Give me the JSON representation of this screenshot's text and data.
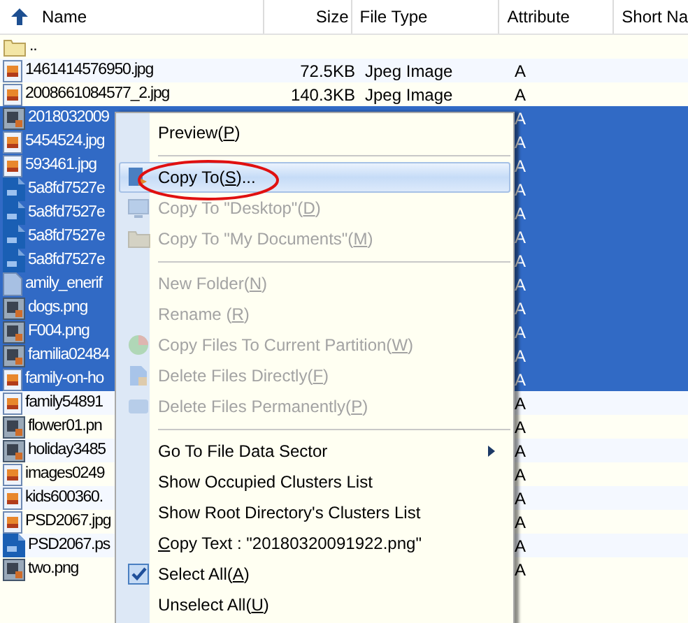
{
  "columns": [
    {
      "label": "Name"
    },
    {
      "label": "Size"
    },
    {
      "label": "File Type"
    },
    {
      "label": "Attribute"
    },
    {
      "label": "Short Na"
    }
  ],
  "rows": [
    {
      "kind": "folder",
      "name": "..",
      "selected": false
    },
    {
      "kind": "jpg",
      "name": "1461414576950.jpg",
      "size": "72.5KB",
      "type": "Jpeg Image",
      "attribute": "A",
      "selected": false
    },
    {
      "kind": "jpg",
      "name": "2008661084577_2.jpg",
      "size": "140.3KB",
      "type": "Jpeg Image",
      "attribute": "A",
      "selected": false
    },
    {
      "kind": "png",
      "name": "2018032009",
      "attribute": "A",
      "selected": true
    },
    {
      "kind": "jpg",
      "name": "5454524.jpg",
      "attribute": "A",
      "selected": true
    },
    {
      "kind": "jpg",
      "name": "593461.jpg",
      "attribute": "A",
      "selected": true
    },
    {
      "kind": "psd",
      "name": "5a8fd7527e",
      "attribute": "A",
      "selected": true
    },
    {
      "kind": "psd",
      "name": "5a8fd7527e",
      "attribute": "A",
      "selected": true
    },
    {
      "kind": "psd",
      "name": "5a8fd7527e",
      "attribute": "A",
      "selected": true
    },
    {
      "kind": "psd",
      "name": "5a8fd7527e",
      "attribute": "A",
      "selected": true
    },
    {
      "kind": "file",
      "name": "amily_enerif",
      "attribute": "A",
      "selected": true
    },
    {
      "kind": "png",
      "name": "dogs.png",
      "attribute": "A",
      "selected": true
    },
    {
      "kind": "png",
      "name": "F004.png",
      "attribute": "A",
      "selected": true
    },
    {
      "kind": "png",
      "name": "familia02484",
      "attribute": "A",
      "selected": true
    },
    {
      "kind": "jpg",
      "name": "family-on-ho",
      "attribute": "A",
      "selected": true
    },
    {
      "kind": "jpg",
      "name": "family54891",
      "attribute": "A",
      "selected": false
    },
    {
      "kind": "png",
      "name": "flower01.pn",
      "attribute": "A",
      "selected": false
    },
    {
      "kind": "png",
      "name": "holiday3485",
      "attribute": "A",
      "selected": false
    },
    {
      "kind": "jpg",
      "name": "images0249",
      "attribute": "A",
      "selected": false
    },
    {
      "kind": "jpg",
      "name": "kids600360.",
      "attribute": "A",
      "selected": false
    },
    {
      "kind": "jpg",
      "name": "PSD2067.jpg",
      "attribute": "A",
      "selected": false
    },
    {
      "kind": "psd",
      "name": "PSD2067.ps",
      "attribute": "A",
      "selected": false
    },
    {
      "kind": "png",
      "name": "two.png",
      "attribute": "A",
      "selected": false
    }
  ],
  "context_menu": [
    {
      "kind": "item",
      "pre": "Preview(",
      "key": "P",
      "post": ")",
      "disabled": false,
      "highlighted": false
    },
    {
      "kind": "separator"
    },
    {
      "kind": "item",
      "pre": "Copy To(",
      "key": "S",
      "post": ")...",
      "disabled": false,
      "highlighted": true
    },
    {
      "kind": "item",
      "pre": "Copy To \"Desktop\"(",
      "key": "D",
      "post": ")",
      "disabled": true,
      "highlighted": false
    },
    {
      "kind": "item",
      "pre": "Copy To \"My Documents\"(",
      "key": "M",
      "post": ")",
      "disabled": true,
      "highlighted": false
    },
    {
      "kind": "separator"
    },
    {
      "kind": "item",
      "pre": "New Folder(",
      "key": "N",
      "post": ")",
      "disabled": true,
      "highlighted": false
    },
    {
      "kind": "item",
      "pre": "Rename (",
      "key": "R",
      "post": ")",
      "disabled": true,
      "highlighted": false
    },
    {
      "kind": "item",
      "pre": "Copy Files To Current Partition(",
      "key": "W",
      "post": ")",
      "disabled": true,
      "highlighted": false
    },
    {
      "kind": "item",
      "pre": "Delete Files Directly(",
      "key": "F",
      "post": ")",
      "disabled": true,
      "highlighted": false
    },
    {
      "kind": "item",
      "pre": "Delete Files Permanently(",
      "key": "P",
      "post": ")",
      "disabled": true,
      "highlighted": false
    },
    {
      "kind": "separator"
    },
    {
      "kind": "submenu",
      "pre": "Go To File Data Sector",
      "disabled": false,
      "highlighted": false
    },
    {
      "kind": "item",
      "pre": "Show Occupied Clusters List",
      "disabled": false,
      "highlighted": false
    },
    {
      "kind": "item",
      "pre": "Show Root Directory's Clusters List",
      "disabled": false,
      "highlighted": false
    },
    {
      "kind": "item",
      "key": "C",
      "post": "opy Text : \"20180320091922.png\"",
      "disabled": false,
      "highlighted": false
    },
    {
      "kind": "item",
      "pre": "Select All(",
      "key": "A",
      "post": ")",
      "disabled": false,
      "highlighted": false
    },
    {
      "kind": "item",
      "pre": "Unselect All(",
      "key": "U",
      "post": ")",
      "disabled": false,
      "highlighted": false
    }
  ]
}
